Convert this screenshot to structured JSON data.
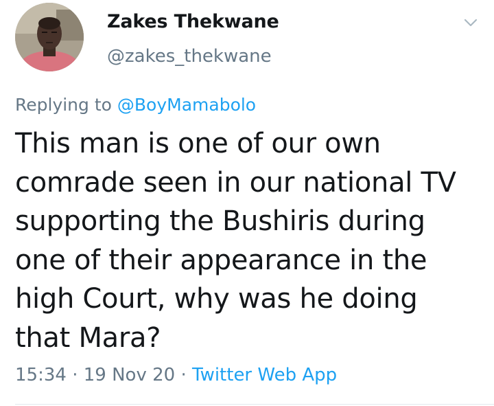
{
  "author": {
    "display_name": "Zakes Thekwane",
    "handle": "@zakes_thekwane"
  },
  "reply": {
    "prefix": "Replying to ",
    "mention": "@BoyMamabolo"
  },
  "tweet": {
    "lines": [
      "This man is one of our own",
      "comrade seen in our national TV",
      "supporting the Bushiris during",
      "one of their appearance in the",
      "high Court, why was he doing",
      "that Mara?"
    ]
  },
  "meta": {
    "time": "15:34",
    "separator1": " · ",
    "date": "19 Nov 20",
    "separator2": " · ",
    "source": "Twitter Web App"
  },
  "icons": {
    "avatar": "profile-photo",
    "more": "chevron-down-icon"
  },
  "colors": {
    "text": "#14171a",
    "secondary": "#657786",
    "link": "#1da1f2",
    "divider": "#e1e8ed"
  }
}
